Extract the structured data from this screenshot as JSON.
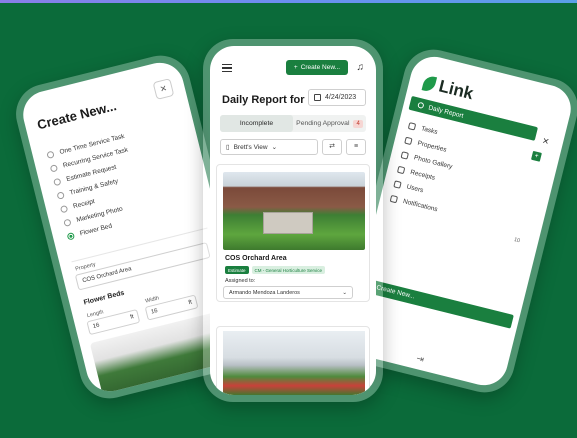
{
  "left_phone": {
    "title": "Create New...",
    "close": "×",
    "options": [
      "One Time Service Task",
      "Recurring Service Task",
      "Estimate Request",
      "Training & Safety",
      "Receipt",
      "Marketing Photo",
      "Flower Bed"
    ],
    "selected_index": 6,
    "property_label": "Property",
    "property_value": "COS Orchard Area",
    "flower_beds_title": "Flower Beds",
    "length_label": "Length",
    "width_label": "Width",
    "length_value": "16",
    "width_value": "16",
    "unit": "ft"
  },
  "center_phone": {
    "create_button": "Create New...",
    "title": "Daily Report for",
    "date": "4/24/2023",
    "tabs": [
      {
        "label": "Incomplete"
      },
      {
        "label": "Pending Approval",
        "badge": "4"
      }
    ],
    "view_select": "Brett's View",
    "card": {
      "location": "COS Orchard Area",
      "tag_estimate": "Estimate",
      "tag_service": "CM - General Horticulture Service",
      "assigned_label": "Assigned to:",
      "assigned_value": "Armando Mendoza Landeros"
    }
  },
  "right_phone": {
    "logo": "Link",
    "close": "×",
    "active_item": "Daily Report",
    "items": [
      "Tasks",
      "Properties",
      "Photo Gallery",
      "Receipts",
      "Users",
      "Notifications"
    ],
    "notifications_count": "10",
    "create_button": "Create New..."
  },
  "colors": {
    "background": "#0b6b3a",
    "brand_green": "#1a7f3f",
    "badge_red": "#c0392b"
  }
}
